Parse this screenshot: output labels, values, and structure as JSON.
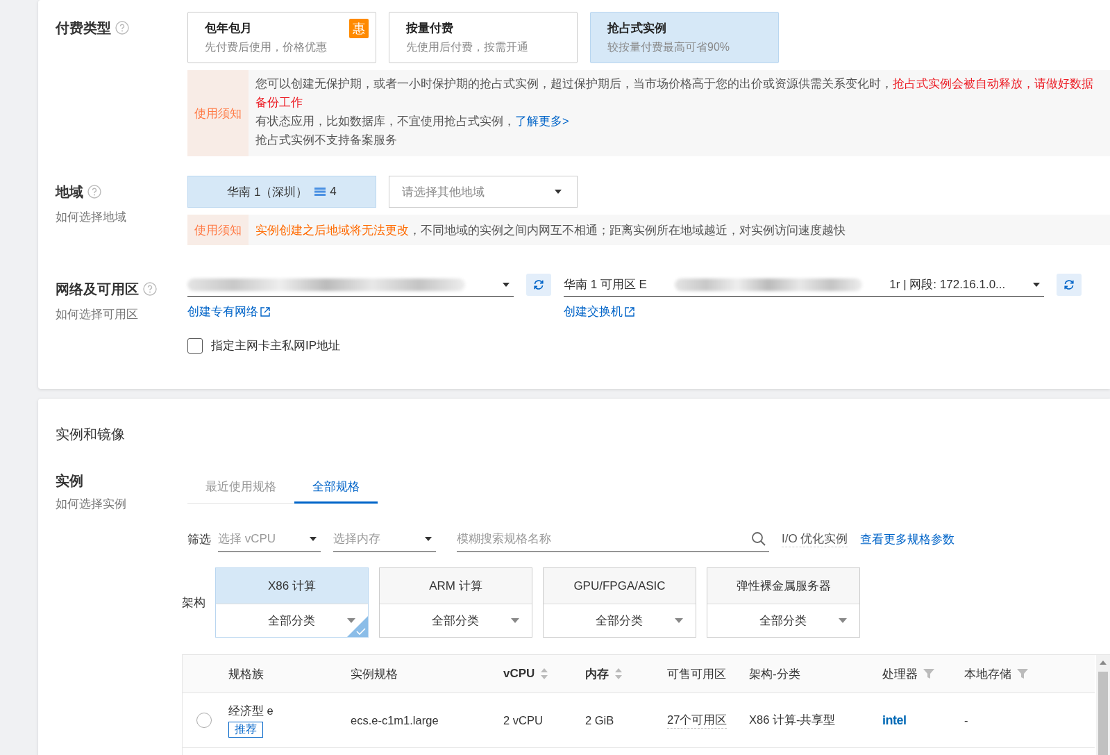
{
  "billing": {
    "label": "付费类型",
    "options": [
      {
        "title": "包年包月",
        "desc": "先付费后使用，价格优惠",
        "badge": "惠",
        "selected": false
      },
      {
        "title": "按量付费",
        "desc": "先使用后付费，按需开通",
        "selected": false
      },
      {
        "title": "抢占式实例",
        "desc": "较按量付费最高可省90%",
        "selected": true
      }
    ],
    "notice": {
      "label": "使用须知",
      "lines": [
        [
          {
            "kind": "normal",
            "text": "您可以创建无保护期，或者一小时保护期的抢占式实例，超过保护期后，当市场价格高于您的出价或资源供需关系变化时，"
          },
          {
            "kind": "danger",
            "text": "抢占式实例会被自动释放，请做好数据备份工作"
          }
        ],
        [
          {
            "kind": "normal",
            "text": "有状态应用，比如数据库，不宜使用抢占式实例，"
          },
          {
            "kind": "link",
            "text": "了解更多>"
          }
        ],
        [
          {
            "kind": "normal",
            "text": "抢占式实例不支持备案服务"
          }
        ]
      ]
    }
  },
  "region": {
    "label": "地域",
    "help": "如何选择地域",
    "current": "华南 1（深圳）",
    "count": "4",
    "select_placeholder": "请选择其他地域",
    "notice": {
      "label": "使用须知",
      "lines": [
        [
          {
            "kind": "warning",
            "text": "实例创建之后地域将无法更改"
          },
          {
            "kind": "normal",
            "text": "，不同地域的实例之间内网互不相通；距离实例所在地域越近，对实例访问速度越快"
          }
        ]
      ]
    }
  },
  "network": {
    "label": "网络及可用区",
    "help": "如何选择可用区",
    "vpc_link": "创建专有网络",
    "vswitch_prefix": "华南 1 可用区 E",
    "vswitch_suffix": "1r | 网段: 172.16.1.0...",
    "vswitch_link": "创建交换机",
    "checkbox": {
      "label": "指定主网卡主私网IP地址",
      "checked": false
    }
  },
  "instance": {
    "title": "实例和镜像",
    "label": "实例",
    "help": "如何选择实例",
    "tabs": [
      {
        "label": "最近使用规格",
        "selected": false
      },
      {
        "label": "全部规格",
        "selected": true
      }
    ],
    "filter_label": "筛选",
    "vcpu_placeholder": "选择 vCPU",
    "memory_placeholder": "选择内存",
    "search_placeholder": "模糊搜索规格名称",
    "io_label": "I/O 优化实例",
    "more_link": "查看更多规格参数",
    "arch_label": "架构",
    "arch": [
      {
        "title": "X86 计算",
        "category": "全部分类",
        "selected": true
      },
      {
        "title": "ARM 计算",
        "category": "全部分类",
        "selected": false
      },
      {
        "title": "GPU/FPGA/ASIC",
        "category": "全部分类",
        "selected": false
      },
      {
        "title": "弹性裸金属服务器",
        "category": "全部分类",
        "selected": false
      }
    ],
    "table": {
      "columns": [
        {
          "label": "规格族",
          "kind": "plain"
        },
        {
          "label": "实例规格",
          "kind": "plain"
        },
        {
          "label": "vCPU",
          "kind": "sort"
        },
        {
          "label": "内存",
          "kind": "sort"
        },
        {
          "label": "可售可用区",
          "kind": "plain"
        },
        {
          "label": "架构-分类",
          "kind": "plain"
        },
        {
          "label": "处理器",
          "kind": "filter"
        },
        {
          "label": "本地存储",
          "kind": "filter"
        }
      ],
      "rows": [
        {
          "selected": false,
          "family": "经济型 e",
          "tag": "推荐",
          "spec": "ecs.e-c1m1.large",
          "vcpu": "2 vCPU",
          "memory": "2 GiB",
          "zones": "27个可用区",
          "arch": "X86 计算-共享型",
          "processor": "intel",
          "storage": "-"
        }
      ]
    }
  }
}
